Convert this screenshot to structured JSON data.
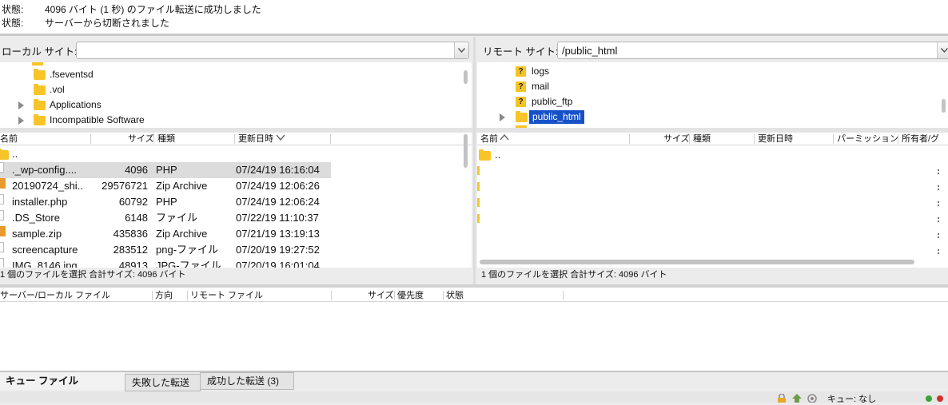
{
  "log": [
    {
      "key": "状態:",
      "text": "4096 バイト (1 秒) のファイル転送に成功しました"
    },
    {
      "key": "状態:",
      "text": "サーバーから切断されました"
    }
  ],
  "local": {
    "site_label": "ローカル サイト:",
    "path_value": "",
    "tree": [
      {
        "name": ".fseventsd",
        "expandable": false
      },
      {
        "name": ".vol",
        "expandable": false
      },
      {
        "name": "Applications",
        "expandable": true
      },
      {
        "name": "Incompatible Software",
        "expandable": true
      }
    ],
    "columns": {
      "name": "名前",
      "size": "サイズ",
      "type": "種類",
      "modified": "更新日時"
    },
    "files": [
      {
        "name": "..",
        "size": "",
        "type": "",
        "modified": "",
        "icon": "folder"
      },
      {
        "name": "._wp-config....",
        "size": "4096",
        "type": "PHP",
        "modified": "07/24/19 16:16:04",
        "icon": "file",
        "selected": true
      },
      {
        "name": "20190724_shi..",
        "size": "29576721",
        "type": "Zip Archive",
        "modified": "07/24/19 12:06:26",
        "icon": "zip"
      },
      {
        "name": "installer.php",
        "size": "60792",
        "type": "PHP",
        "modified": "07/24/19 12:06:24",
        "icon": "file"
      },
      {
        "name": ".DS_Store",
        "size": "6148",
        "type": "ファイル",
        "modified": "07/22/19 11:10:37",
        "icon": "file"
      },
      {
        "name": "sample.zip",
        "size": "435836",
        "type": "Zip Archive",
        "modified": "07/21/19 13:19:13",
        "icon": "zip"
      },
      {
        "name": "screencapture",
        "size": "283512",
        "type": "png-ファイル",
        "modified": "07/20/19 19:27:52",
        "icon": "file"
      },
      {
        "name": "IMG_8146.jpg",
        "size": "48913",
        "type": "JPG-ファイル",
        "modified": "07/20/19 16:01:04",
        "icon": "file"
      }
    ],
    "status": "1 個のファイルを選択 合計サイズ: 4096 バイト"
  },
  "remote": {
    "site_label": "リモート サイト:",
    "path_value": "/public_html",
    "tree": [
      {
        "name": "logs",
        "icon": "unknown"
      },
      {
        "name": "mail",
        "icon": "unknown"
      },
      {
        "name": "public_ftp",
        "icon": "unknown"
      },
      {
        "name": "public_html",
        "icon": "folder",
        "selected": true
      }
    ],
    "columns": {
      "name": "名前",
      "size": "サイズ",
      "type": "種類",
      "modified": "更新日時",
      "perm": "パーミッション",
      "owner": "所有者/グ"
    },
    "files": [
      {
        "name": "..",
        "icon": "folder"
      }
    ],
    "status": "1 個のファイルを選択 合計サイズ: 4096 バイト"
  },
  "queue": {
    "columns": {
      "file": "サーバー/ローカル ファイル",
      "direction": "方向",
      "remote": "リモート ファイル",
      "size": "サイズ",
      "priority": "優先度",
      "status": "状態"
    }
  },
  "tabs": [
    "キュー ファイル",
    "失敗した転送",
    "成功した転送 (3)"
  ],
  "bottom": {
    "queue_status": "キュー: なし"
  },
  "colors": {
    "selection": "#1651c8",
    "folder": "#f8c427",
    "zip": "#e99a2c"
  }
}
